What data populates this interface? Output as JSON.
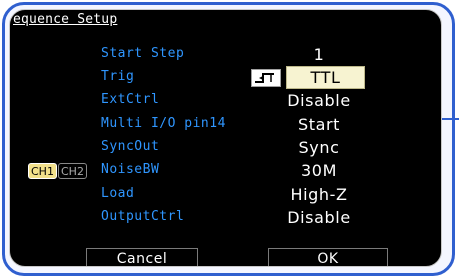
{
  "title": "equence Setup",
  "channels": {
    "ch1": "CH1",
    "ch2": "CH2"
  },
  "rows": [
    {
      "label": "Start Step",
      "value": "1"
    },
    {
      "label": "Trig",
      "value": "TTL"
    },
    {
      "label": "ExtCtrl",
      "value": "Disable"
    },
    {
      "label": "Multi I/O pin14",
      "value": "Start"
    },
    {
      "label": "SyncOut",
      "value": "Sync"
    },
    {
      "label": "NoiseBW",
      "value": "30M"
    },
    {
      "label": "Load",
      "value": "High-Z"
    },
    {
      "label": "OutputCtrl",
      "value": "Disable"
    }
  ],
  "buttons": {
    "cancel": "Cancel",
    "ok": "OK"
  },
  "icons": {
    "trig": "trigger-edge-icon"
  },
  "colors": {
    "background": "#000000",
    "label": "#2f96ff",
    "value": "#ffffff",
    "frame": "#2f5fcf",
    "selected_bg": "#f7f3d1",
    "ch1_badge": "#f2e08a"
  }
}
